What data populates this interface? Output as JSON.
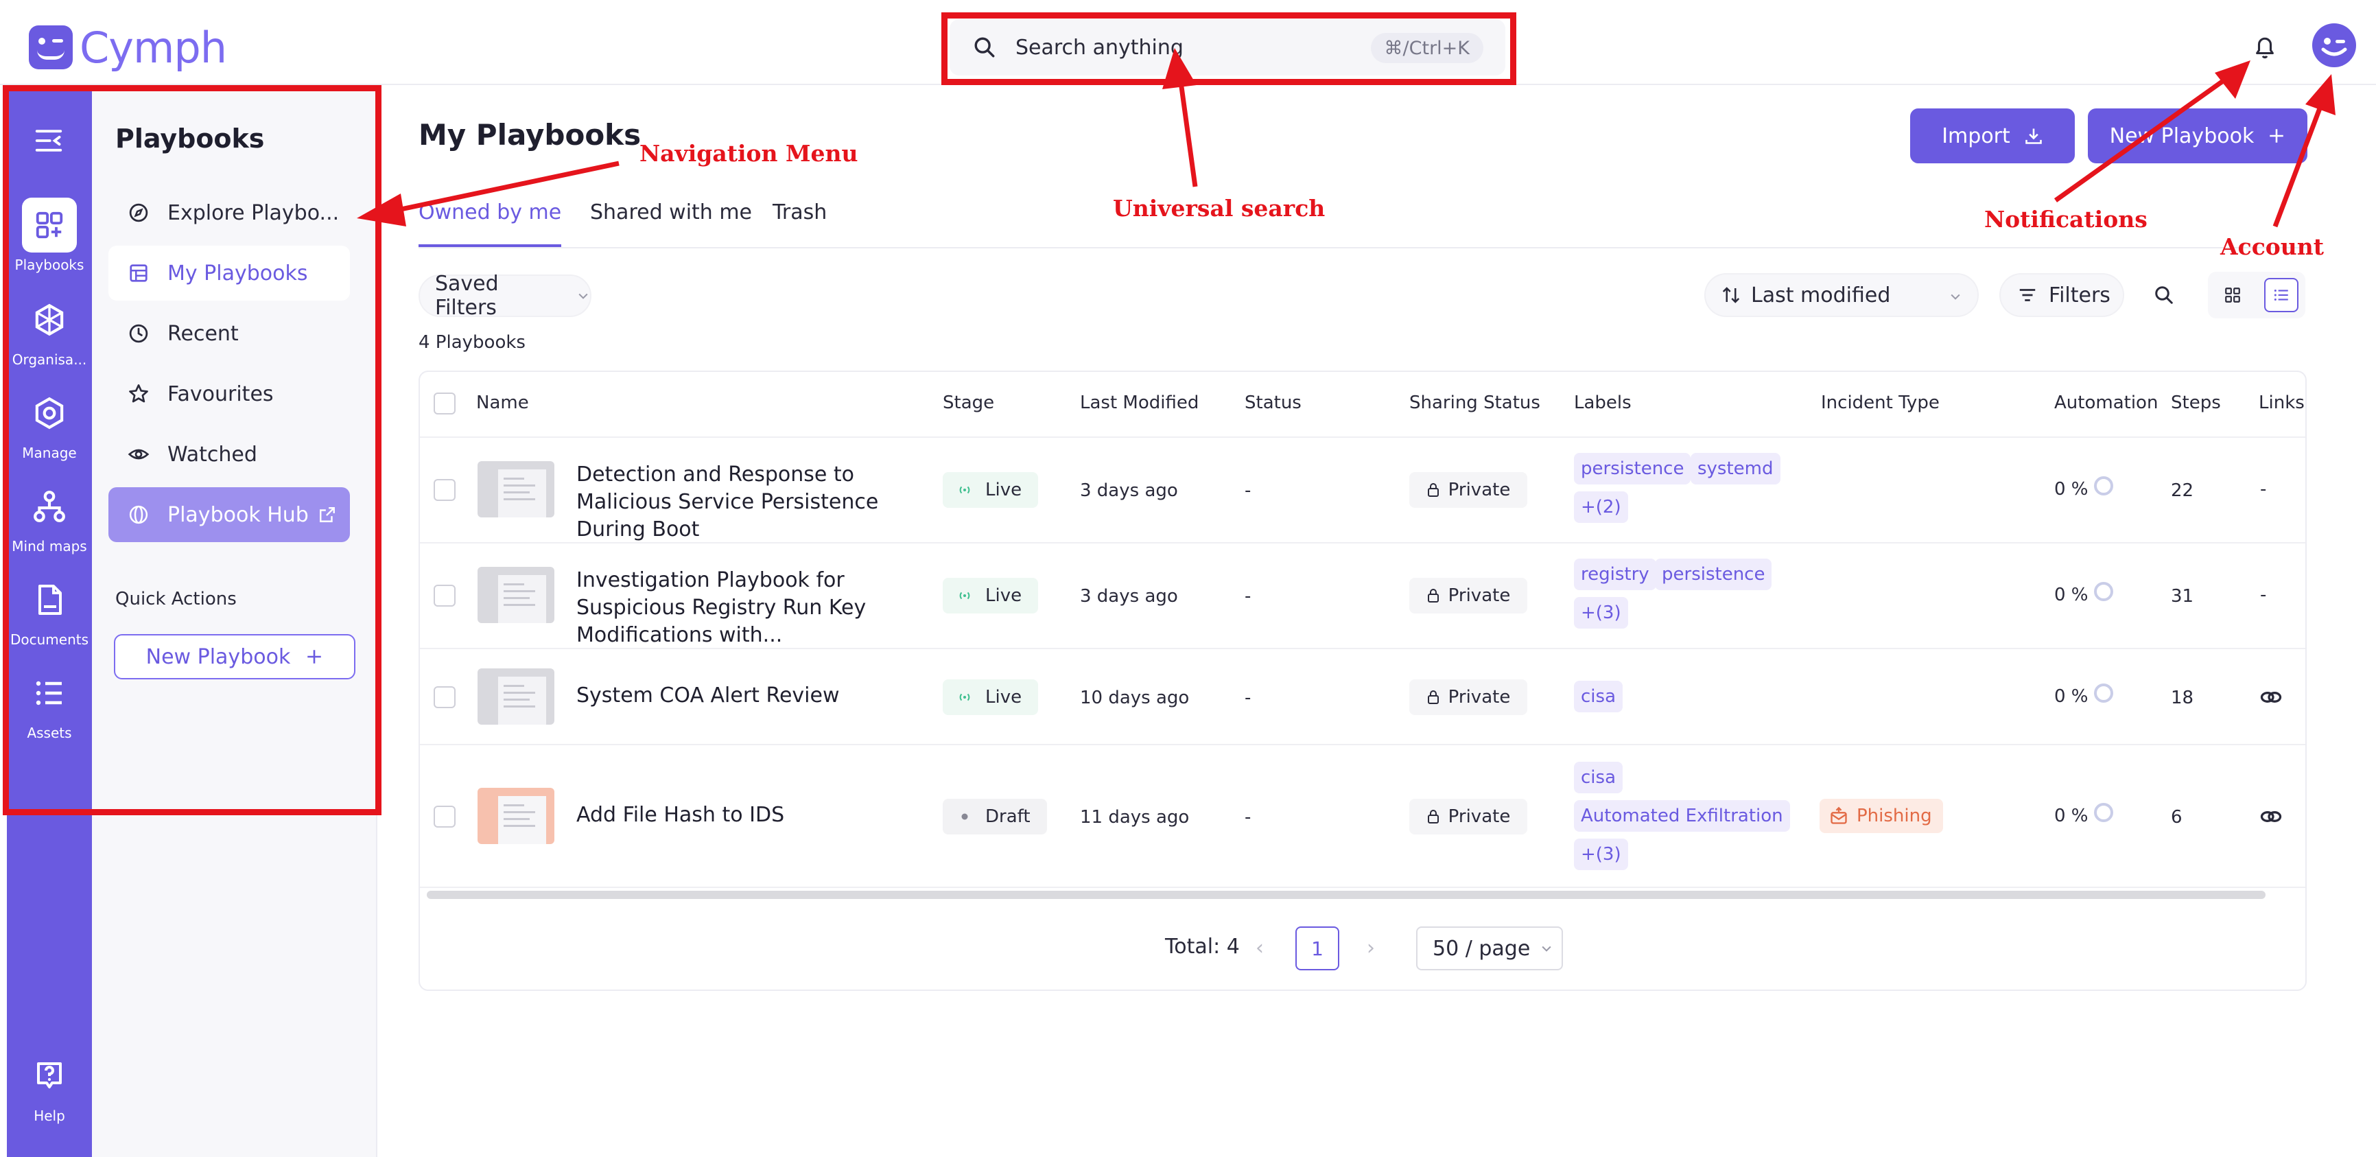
{
  "app": {
    "name": "Cymph"
  },
  "search": {
    "placeholder": "Search anything",
    "shortcut": "⌘/Ctrl+K"
  },
  "rail": {
    "items": [
      {
        "label": "Playbooks",
        "icon": "playbooks-icon",
        "active": true
      },
      {
        "label": "Organisa...",
        "icon": "organisation-icon"
      },
      {
        "label": "Manage",
        "icon": "manage-icon"
      },
      {
        "label": "Mind maps",
        "icon": "mind-maps-icon"
      },
      {
        "label": "Documents",
        "icon": "documents-icon"
      },
      {
        "label": "Assets",
        "icon": "assets-icon"
      }
    ],
    "help": "Help"
  },
  "sidepanel": {
    "title": "Playbooks",
    "items": [
      {
        "label": "Explore Playbo...",
        "icon": "compass-icon"
      },
      {
        "label": "My Playbooks",
        "icon": "layout-icon",
        "selected": true
      },
      {
        "label": "Recent",
        "icon": "clock-icon"
      },
      {
        "label": "Favourites",
        "icon": "star-icon"
      },
      {
        "label": "Watched",
        "icon": "eye-icon"
      },
      {
        "label": "Playbook Hub",
        "icon": "globe-icon",
        "external": true
      }
    ],
    "quick_actions_title": "Quick Actions",
    "quick_action_button": "New Playbook"
  },
  "main": {
    "title": "My Playbooks",
    "import_label": "Import",
    "new_label": "New Playbook",
    "tabs": [
      {
        "label": "Owned by me",
        "active": true
      },
      {
        "label": "Shared with me"
      },
      {
        "label": "Trash"
      }
    ],
    "saved_filters": "Saved Filters",
    "count_text": "4 Playbooks",
    "sort_label": "Last modified",
    "filters_label": "Filters"
  },
  "table": {
    "columns": [
      "Name",
      "Stage",
      "Last Modified",
      "Status",
      "Sharing Status",
      "Labels",
      "Incident Type",
      "Automation",
      "Steps",
      "Links"
    ],
    "rows": [
      {
        "name": "Detection and Response to Malicious Service Persistence During Boot",
        "stage": "Live",
        "modified": "3 days ago",
        "status": "-",
        "sharing": "Private",
        "labels": [
          "persistence",
          "systemd",
          "+(2)"
        ],
        "incident": "",
        "automation": "0 %",
        "steps": "22",
        "links": "-"
      },
      {
        "name": "Investigation Playbook for Suspicious Registry Run Key Modifications with...",
        "stage": "Live",
        "modified": "3 days ago",
        "status": "-",
        "sharing": "Private",
        "labels": [
          "registry",
          "persistence",
          "+(3)"
        ],
        "incident": "",
        "automation": "0 %",
        "steps": "31",
        "links": "-"
      },
      {
        "name": "System COA Alert Review",
        "stage": "Live",
        "modified": "10 days ago",
        "status": "-",
        "sharing": "Private",
        "labels": [
          "cisa"
        ],
        "incident": "",
        "automation": "0 %",
        "steps": "18",
        "links": "link-icon"
      },
      {
        "name": "Add File Hash to IDS",
        "stage": "Draft",
        "modified": "11 days ago",
        "status": "-",
        "sharing": "Private",
        "labels": [
          "cisa",
          "Automated Exfiltration",
          "+(3)"
        ],
        "incident": "Phishing",
        "automation": "0 %",
        "steps": "6",
        "links": "link-icon"
      }
    ]
  },
  "pagination": {
    "total": "Total: 4",
    "page": "1",
    "per_page": "50 / page"
  },
  "annotations": {
    "navigation": "Navigation Menu",
    "search": "Universal search",
    "notifications": "Notifications",
    "account": "Account",
    "color": "#e5141c"
  },
  "colors": {
    "brand": "#6a5ae0",
    "live": "#3fbf8f",
    "phishing": "#e26a45"
  }
}
